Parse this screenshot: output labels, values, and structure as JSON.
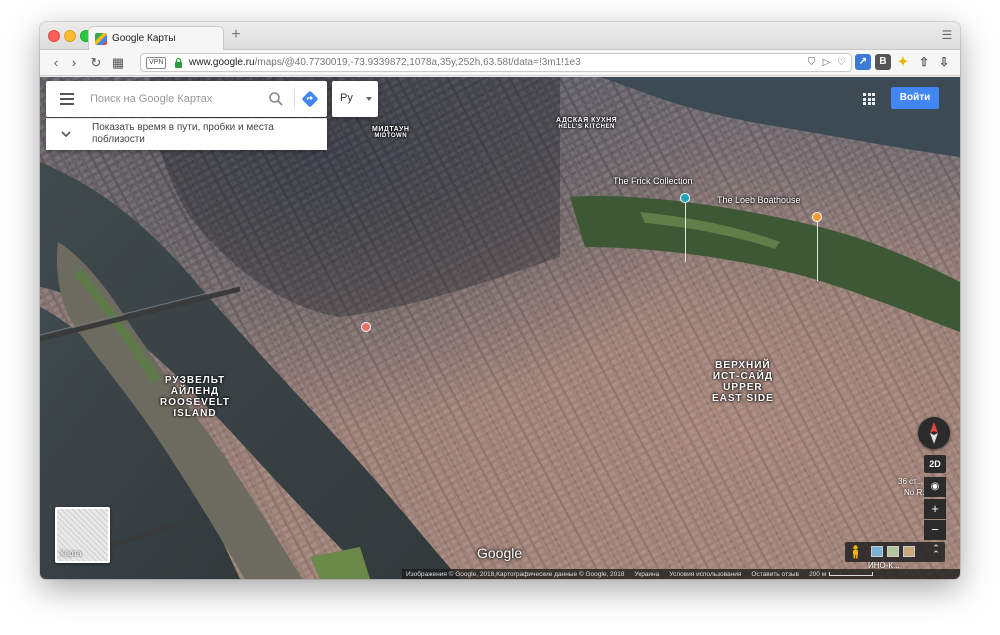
{
  "browser": {
    "tab_title": "Google Карты",
    "new_tab_symbol": "+",
    "address_badge": "VPN",
    "url_host": "www.google.ru",
    "url_path": "/maps/@40.7730019,-73.9339872,1078a,35y,252h,63.58t/data=!3m1!1e3",
    "extension_b_label": "B"
  },
  "search": {
    "placeholder": "Поиск на Google Картах",
    "language": "Ру",
    "traffic_prompt": "Показать время в пути, пробки и места поблизости"
  },
  "header": {
    "signin_label": "Войти"
  },
  "labels": {
    "midtown_ru": "МИДТАУН",
    "midtown_en": "MIDTOWN",
    "hells_kitchen_ru": "АДСКАЯ КУХНЯ",
    "hells_kitchen_en": "HELL'S KITCHEN",
    "roosevelt_ru_1": "РУЗВЕЛЬТ",
    "roosevelt_ru_2": "АЙЛЕНД",
    "roosevelt_en_1": "ROOSEVELT",
    "roosevelt_en_2": "ISLAND",
    "ues_ru_1": "ВЕРХНИЙ",
    "ues_ru_2": "ИСТ-САЙД",
    "ues_en_1": "UPPER",
    "ues_en_2": "EAST SIDE"
  },
  "pois": {
    "frick": "The Frick Collection",
    "loeb": "The Loeb Boathouse"
  },
  "colors": {
    "frick_pin": "#1fa5b8",
    "loeb_pin": "#f29b38",
    "hospital_pin": "#e8726a",
    "signin": "#4285f4"
  },
  "thumbnail": {
    "label": "Карта"
  },
  "branding": {
    "logo_text": "Google"
  },
  "controls": {
    "mode_2d": "2D",
    "zoom_in": "+",
    "zoom_out": "−"
  },
  "edge_labels": {
    "street_partial": "36 ст...",
    "noho_partial": "No R...",
    "bottom_partial": "ИНО-К..."
  },
  "footer": {
    "attribution": "Изображения © Google, 2018,Картографические данные © Google, 2018",
    "country": "Украина",
    "terms": "Условия использования",
    "feedback": "Оставить отзыв",
    "scale": "200 м"
  }
}
